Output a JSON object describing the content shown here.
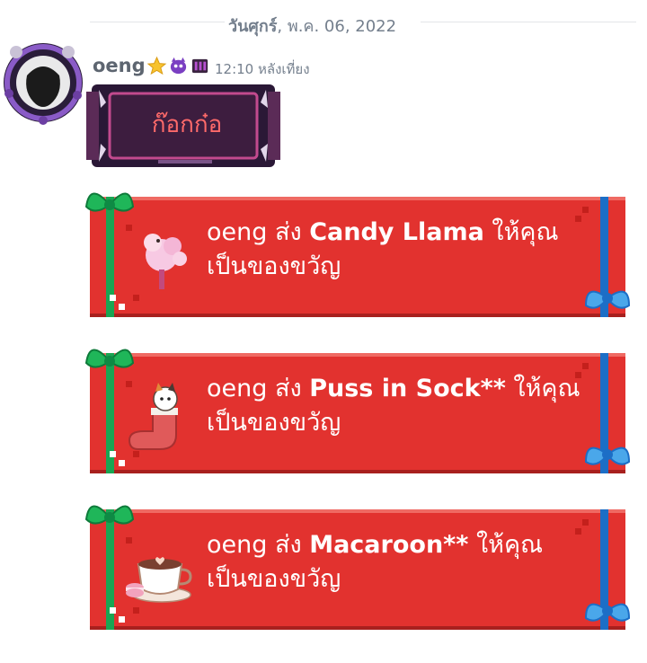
{
  "date_divider": {
    "day": "วันศุกร์",
    "rest": ", พ.ค. 06, 2022"
  },
  "message": {
    "author": "oeng",
    "timestamp": "12:10 หลังเที่ยง",
    "badges": [
      "star-badge-icon",
      "purple-monster-badge-icon",
      "dark-badge-icon"
    ],
    "nameplate_text": "ก๊อกก๋อ"
  },
  "gifts": [
    {
      "sender": "oeng",
      "verb": " ส่ง ",
      "item": "Candy Llama",
      "suffix": " ให้คุณ",
      "line2": "เป็นของขวัญ",
      "icon": "candy-llama-icon"
    },
    {
      "sender": "oeng",
      "verb": " ส่ง ",
      "item": "Puss in Sock**",
      "suffix": " ให้คุณ",
      "line2": "เป็นของขวัญ",
      "icon": "puss-in-sock-icon"
    },
    {
      "sender": "oeng",
      "verb": " ส่ง ",
      "item": "Macaroon**",
      "suffix": " ให้คุณ",
      "line2": "เป็นของขวัญ",
      "icon": "macaroon-cup-icon"
    }
  ],
  "colors": {
    "card": "#e2322f",
    "ribbon_green": "#1aa553",
    "ribbon_blue": "#1c6ec6",
    "nameplate_text": "#ff6a6a"
  }
}
